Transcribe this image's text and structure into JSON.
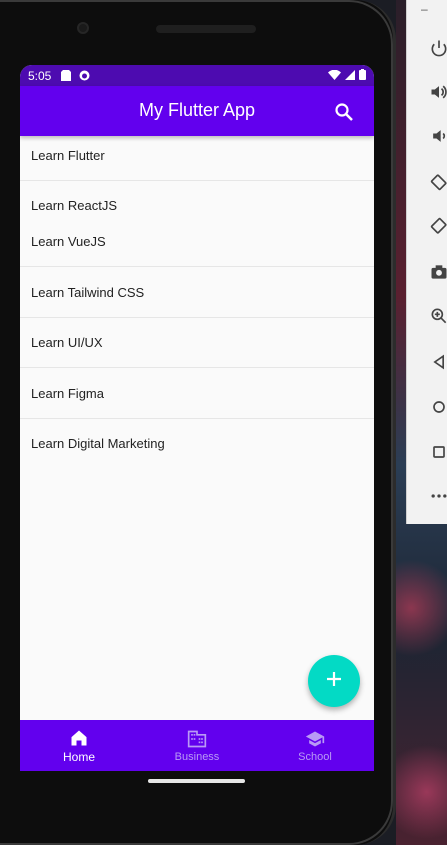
{
  "status_bar": {
    "time": "5:05",
    "left_icons": [
      "sd-card-icon",
      "app-notification-icon"
    ],
    "right_icons": [
      "wifi-icon",
      "signal-icon",
      "battery-icon"
    ]
  },
  "app_bar": {
    "title": "My Flutter App",
    "search_icon": "search-icon"
  },
  "list": {
    "items": [
      "Learn Flutter",
      "Learn ReactJS",
      "Learn VueJS",
      "Learn Tailwind CSS",
      "Learn UI/UX",
      "Learn Figma",
      "Learn Digital Marketing"
    ]
  },
  "fab": {
    "icon": "add-icon",
    "label": "+"
  },
  "bottom_nav": {
    "items": [
      {
        "label": "Home",
        "icon": "home-icon",
        "active": true
      },
      {
        "label": "Business",
        "icon": "business-icon",
        "active": false
      },
      {
        "label": "School",
        "icon": "school-icon",
        "active": false
      }
    ]
  },
  "emulator_toolbar": {
    "minimize": "–",
    "buttons": [
      "power-icon",
      "volume-up-icon",
      "volume-down-icon",
      "rotate-left-icon",
      "rotate-right-icon",
      "camera-icon",
      "zoom-icon",
      "back-icon",
      "home-circle-icon",
      "overview-icon",
      "more-icon"
    ]
  },
  "colors": {
    "primary": "#6200ee",
    "status_bar": "#4d0bb0",
    "accent": "#03dac5",
    "background": "#fafafa"
  }
}
